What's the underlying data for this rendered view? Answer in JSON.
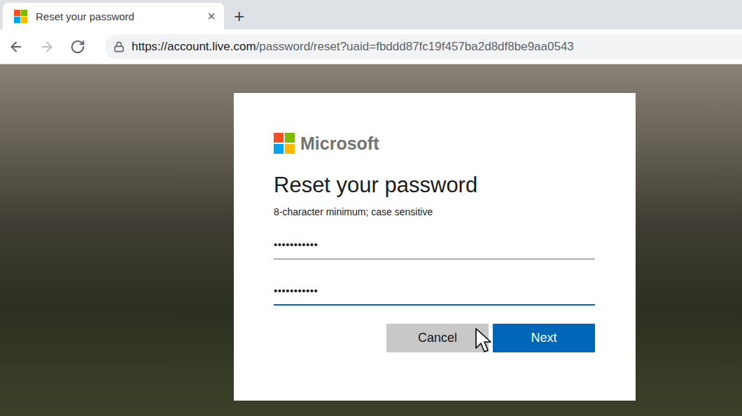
{
  "window": {
    "title": "Reset your password",
    "close": "×",
    "new_tab": "+"
  },
  "nav": [
    {
      "name": "back",
      "disabled": false
    },
    {
      "name": "forward",
      "disabled": true
    },
    {
      "name": "reload",
      "disabled": false
    }
  ],
  "address": {
    "secure": true,
    "host": "https://account.live.com",
    "path": "/password/reset?uaid=fbddd87fc19f457ba2d8df8be9aa0543"
  },
  "dialog": {
    "brand": "Microsoft",
    "title": "Reset your password",
    "hint": "8-character minimum; case sensitive",
    "fields": [
      {
        "value": "•••••••••••",
        "focused": false
      },
      {
        "value": "•••••••••••",
        "focused": true
      }
    ],
    "buttons": [
      {
        "label": "Cancel",
        "primary": false,
        "hovered": true
      },
      {
        "label": "Next",
        "primary": true,
        "hovered": false
      }
    ]
  }
}
